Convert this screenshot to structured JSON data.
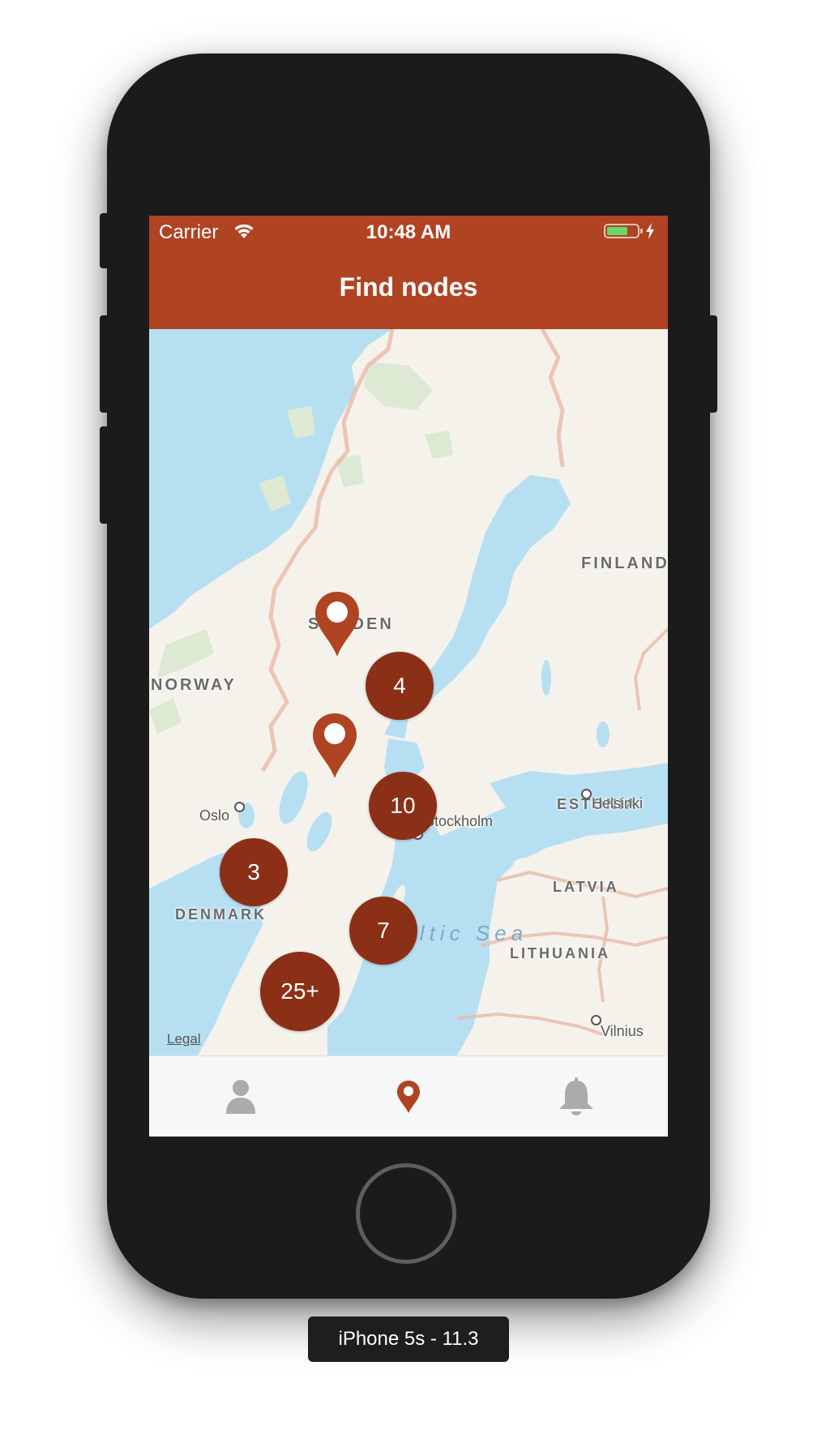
{
  "status_bar": {
    "carrier": "Carrier",
    "time": "10:48 AM",
    "battery_level": 0.7,
    "battery_color": "#66d96a",
    "charging_icon": "bolt-icon",
    "wifi_icon": "wifi-icon"
  },
  "nav": {
    "title": "Find nodes"
  },
  "colors": {
    "brand": "#b04322",
    "cluster": "#8c2f17",
    "water": "#b7dff2",
    "land": "#f5f2ec"
  },
  "map": {
    "countries": {
      "finland": "FINLAND",
      "sweden": "SWEDEN",
      "norway": "NORWAY",
      "estonia": "ESTONIA",
      "latvia": "LATVIA",
      "lithuania": "LITHUANIA",
      "denmark": "DENMARK"
    },
    "cities": {
      "oslo": "Oslo",
      "helsinki": "Helsinki",
      "stockholm": "Stockholm",
      "vilnius": "Vilnius"
    },
    "sea": "Baltic Sea",
    "legal": "Legal",
    "clusters": [
      {
        "label": "4"
      },
      {
        "label": "10"
      },
      {
        "label": "3"
      },
      {
        "label": "7"
      },
      {
        "label": "25+"
      }
    ],
    "pins": [
      {
        "icon": "map-pin-icon"
      },
      {
        "icon": "map-pin-icon"
      }
    ]
  },
  "tab_bar": {
    "tabs": [
      {
        "icon": "person-icon",
        "active": false
      },
      {
        "icon": "map-pin-icon",
        "active": true
      },
      {
        "icon": "bell-icon",
        "active": false
      }
    ]
  },
  "simulator": {
    "device_label": "iPhone 5s - 11.3"
  }
}
